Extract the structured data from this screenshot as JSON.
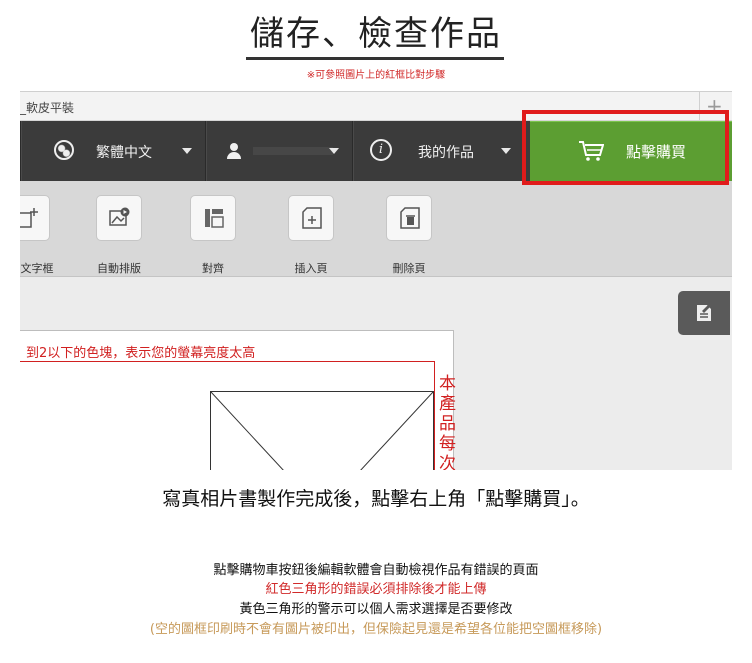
{
  "header": {
    "title": "儲存、檢查作品",
    "subtitle": "※可參照圖片上的紅框比對步驟"
  },
  "screenshot": {
    "tab_title": "_軟皮平裝",
    "plus_glyph": "+",
    "nav": {
      "language_label": "繁體中文",
      "my_works_label": "我的作品",
      "buy_button_label": "點擊購買"
    },
    "toolbar": {
      "items": [
        {
          "label": "文字框",
          "icon": "add-text-icon"
        },
        {
          "label": "自動排版",
          "icon": "auto-layout-icon"
        },
        {
          "label": "對齊",
          "icon": "align-icon"
        },
        {
          "label": "插入頁",
          "icon": "insert-page-icon"
        },
        {
          "label": "刪除頁",
          "icon": "delete-page-icon"
        }
      ]
    },
    "canvas": {
      "warning_text": "到2以下的色塊，表示您的螢幕亮度太高",
      "vertical_text": "本產品每次"
    },
    "colors": {
      "buy_green": "#5c9e32",
      "highlight_red": "#e01b1b",
      "nav_dark": "#3b3b3b"
    }
  },
  "instruction": "寫真相片書製作完成後，點擊右上角「點擊購買」。",
  "notes": [
    "點擊購物車按鈕後編輯軟體會自動檢視作品有錯誤的頁面",
    "紅色三角形的錯誤必須排除後才能上傳",
    "黃色三角形的警示可以個人需求選擇是否要修改",
    "(空的圖框印刷時不會有圖片被印出，但保險起見還是希望各位能把空圖框移除)"
  ]
}
